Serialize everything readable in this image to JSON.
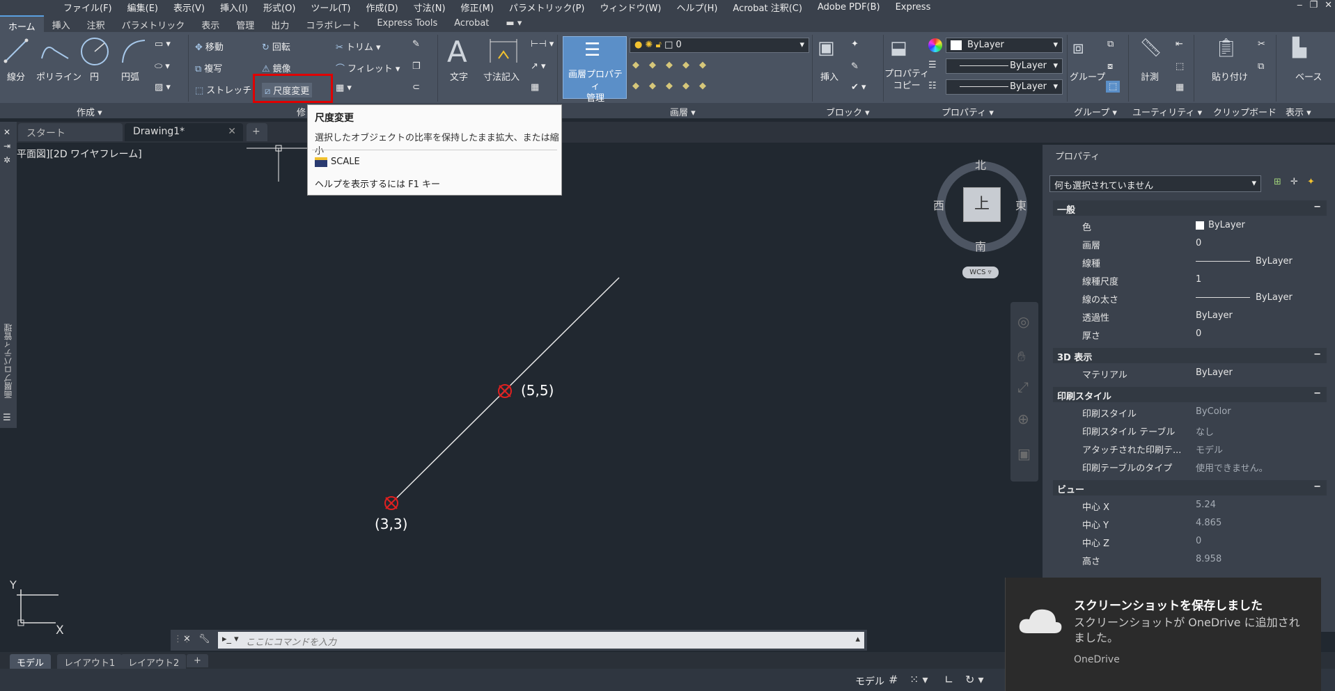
{
  "menu": [
    "ファイル(F)",
    "編集(E)",
    "表示(V)",
    "挿入(I)",
    "形式(O)",
    "ツール(T)",
    "作成(D)",
    "寸法(N)",
    "修正(M)",
    "パラメトリック(P)",
    "ウィンドウ(W)",
    "ヘルプ(H)",
    "Acrobat 注釈(C)",
    "Adobe PDF(B)",
    "Express"
  ],
  "ribbon_tabs": [
    "ホーム",
    "挿入",
    "注釈",
    "パラメトリック",
    "表示",
    "管理",
    "出力",
    "コラボレート",
    "Express Tools",
    "Acrobat"
  ],
  "draw_tools": {
    "line": "線分",
    "polyline": "ポリライン",
    "circle": "円",
    "arc": "円弧"
  },
  "modify_tools": {
    "move": "移動",
    "copy": "複写",
    "stretch": "ストレッチ",
    "rotate": "回転",
    "mirror": "鏡像",
    "scale": "尺度変更",
    "trim": "トリム",
    "fillet": "フィレット"
  },
  "annotation_tools": {
    "text": "文字",
    "dimension": "寸法記入"
  },
  "layer": {
    "manager": "画層プロパティ\n管理",
    "current": "0"
  },
  "block": {
    "insert": "挿入"
  },
  "properties": {
    "match": "プロパティ\nコピー",
    "color": "ByLayer",
    "linetype": "ByLayer",
    "lineweight": "ByLayer"
  },
  "group": {
    "label": "グループ"
  },
  "utilities": {
    "measure": "計測"
  },
  "clipboard": {
    "paste": "貼り付け"
  },
  "view": {
    "base": "ベース"
  },
  "panel_labels": {
    "draw": "作成 ▾",
    "modify": "修",
    "layers": "画層 ▾",
    "block": "ブロック ▾",
    "properties": "プロパティ ▾",
    "groups": "グループ ▾",
    "utilities": "ユーティリティ ▾",
    "clipboard": "クリップボード",
    "view": "表示 ▾"
  },
  "doc_tabs": {
    "start": "スタート",
    "drawing": "Drawing1*"
  },
  "viewport_label": "平面図][2D ワイヤフレーム]",
  "left_palette_label": "画層プロパティ管理",
  "tooltip": {
    "title": "尺度変更",
    "desc": "選択したオブジェクトの比率を保持したまま拡大、または縮小",
    "command": "SCALE",
    "help": "ヘルプを表示するには F1 キー"
  },
  "drawing": {
    "p1_label": "(3,3)",
    "p2_label": "(5,5)"
  },
  "viewcube": {
    "n": "北",
    "s": "南",
    "e": "東",
    "w": "西",
    "top": "上",
    "wcs": "WCS"
  },
  "ucs": {
    "x": "X",
    "y": "Y"
  },
  "props_palette": {
    "title": "プロパティ",
    "selection": "何も選択されていません",
    "sections": [
      {
        "name": "一般",
        "rows": [
          [
            "色",
            "ByLayer"
          ],
          [
            "画層",
            "0"
          ],
          [
            "線種",
            "ByLayer"
          ],
          [
            "線種尺度",
            "1"
          ],
          [
            "線の太さ",
            "ByLayer"
          ],
          [
            "透過性",
            "ByLayer"
          ],
          [
            "厚さ",
            "0"
          ]
        ]
      },
      {
        "name": "3D 表示",
        "rows": [
          [
            "マテリアル",
            "ByLayer"
          ]
        ]
      },
      {
        "name": "印刷スタイル",
        "rows": [
          [
            "印刷スタイル",
            "ByColor"
          ],
          [
            "印刷スタイル テーブル",
            "なし"
          ],
          [
            "アタッチされた印刷テ...",
            "モデル"
          ],
          [
            "印刷テーブルのタイプ",
            "使用できません。"
          ]
        ]
      },
      {
        "name": "ビュー",
        "rows": [
          [
            "中心 X",
            "5.24"
          ],
          [
            "中心 Y",
            "4.865"
          ],
          [
            "中心 Z",
            "0"
          ],
          [
            "高さ",
            "8.958"
          ]
        ]
      }
    ]
  },
  "command_placeholder": "ここにコマンドを入力",
  "layout_tabs": [
    "モデル",
    "レイアウト1",
    "レイアウト2"
  ],
  "status": {
    "model": "モデル"
  },
  "toast": {
    "title": "スクリーンショットを保存しました",
    "body": "スクリーンショットが OneDrive に追加されました。",
    "source": "OneDrive"
  }
}
